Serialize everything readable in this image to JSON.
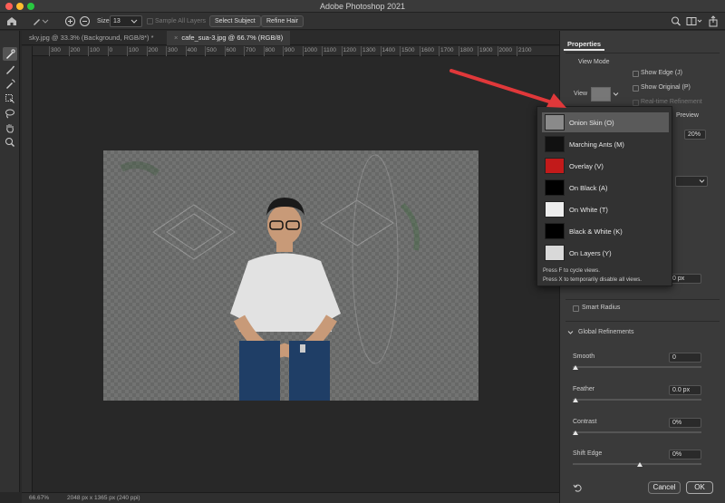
{
  "window": {
    "title": "Adobe Photoshop 2021"
  },
  "options_bar": {
    "size_label": "Size:",
    "size_value": "13",
    "sample_all_layers": "Sample All Layers",
    "select_subject": "Select Subject",
    "refine_hair": "Refine Hair"
  },
  "tabs": [
    {
      "label": "sky.jpg @ 33.3% (Background, RGB/8*) *"
    },
    {
      "label": "cafe_sua-3.jpg @ 66.7% (RGB/8)"
    }
  ],
  "ruler_ticks": [
    "300",
    "200",
    "100",
    "0",
    "100",
    "200",
    "300",
    "400",
    "500",
    "600",
    "700",
    "800",
    "900",
    "1000",
    "1100",
    "1200",
    "1300",
    "1400",
    "1500",
    "1600",
    "1700",
    "1800",
    "1900",
    "2000",
    "2100"
  ],
  "status": {
    "zoom": "66.67%",
    "info": "2048 px x 1365 px (240 ppi)"
  },
  "panel": {
    "tab": "Properties",
    "view_mode": "View Mode",
    "view_label": "View",
    "show_edge": "Show Edge (J)",
    "show_original": "Show Original (P)",
    "realtime": "Real-time Refinement",
    "preview": "Preview",
    "opacity_value": "20%",
    "radius_value": "0 px",
    "smart_radius": "Smart Radius",
    "global_refinements": "Global Refinements",
    "smooth_label": "Smooth",
    "smooth_value": "0",
    "feather_label": "Feather",
    "feather_value": "0.0 px",
    "contrast_label": "Contrast",
    "contrast_value": "0%",
    "shift_edge_label": "Shift Edge",
    "shift_edge_value": "0%",
    "cancel": "Cancel",
    "ok": "OK"
  },
  "view_dropdown": {
    "items": [
      {
        "label": "Onion Skin (O)",
        "selected": true
      },
      {
        "label": "Marching Ants (M)",
        "selected": false
      },
      {
        "label": "Overlay (V)",
        "selected": false
      },
      {
        "label": "On Black (A)",
        "selected": false
      },
      {
        "label": "On White (T)",
        "selected": false
      },
      {
        "label": "Black & White (K)",
        "selected": false
      },
      {
        "label": "On Layers (Y)",
        "selected": false
      }
    ],
    "note1": "Press F to cycle views.",
    "note2": "Press X to temporarily disable all views."
  },
  "colors": {
    "arrow": "#e0383a",
    "selection": "#5a5a5a"
  }
}
